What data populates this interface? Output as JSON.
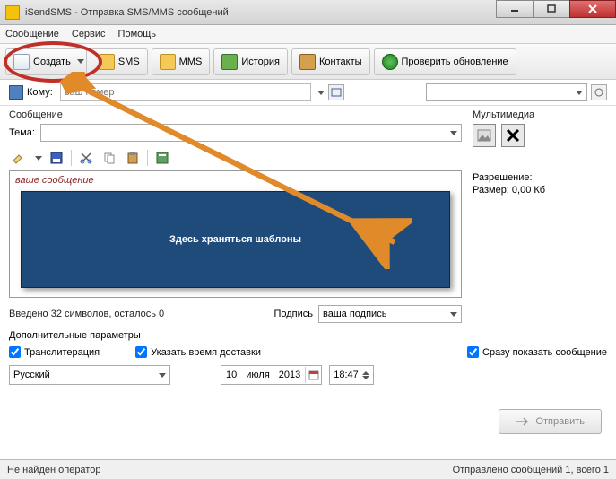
{
  "window": {
    "title": "iSendSMS - Отправка SMS/MMS сообщений"
  },
  "menu": {
    "message": "Сообщение",
    "service": "Сервис",
    "help": "Помощь"
  },
  "toolbar": {
    "create": "Создать",
    "sms": "SMS",
    "mms": "MMS",
    "history": "История",
    "contacts": "Контакты",
    "check_update": "Проверить обновление"
  },
  "recipient": {
    "label": "Кому:",
    "placeholder": "ваш номер"
  },
  "message": {
    "section": "Сообщение",
    "theme_label": "Тема:",
    "placeholder": "ваше сообщение",
    "count_text": "Введено 32 символов, осталось 0",
    "signature_label": "Подпись",
    "signature_value": "ваша подпись"
  },
  "multimedia": {
    "section": "Мультимедиа",
    "resolution_label": "Разрешение:",
    "size_label": "Размер: 0,00 Кб"
  },
  "params": {
    "header": "Дополнительные параметры",
    "translit": "Транслитерация",
    "delivery_time": "Указать время доставки",
    "show_now": "Сразу показать сообщение",
    "language": "Русский",
    "day": "10",
    "month": "июля",
    "year": "2013",
    "time": "18:47"
  },
  "send": {
    "button": "Отправить"
  },
  "status": {
    "left": "Не найден оператор",
    "right": "Отправлено сообщений 1, всего 1"
  },
  "callout": {
    "text": "Здесь храняться шаблоны"
  }
}
